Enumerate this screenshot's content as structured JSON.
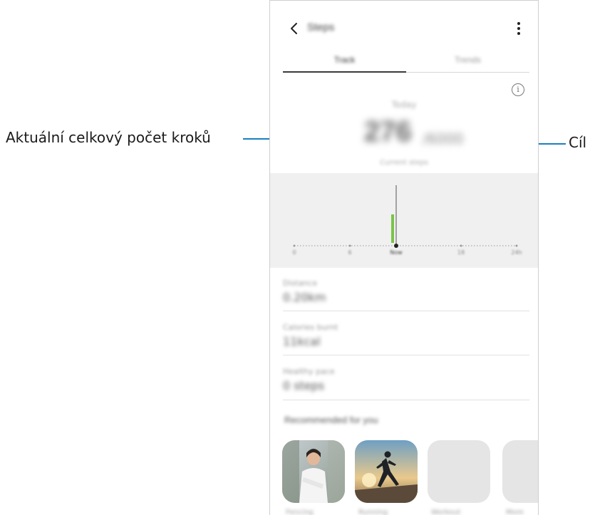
{
  "callouts": {
    "left_label": "Aktuální celkový počet kroků",
    "right_label": "Cíl"
  },
  "app_bar": {
    "title": "Steps"
  },
  "tabs": [
    {
      "label": "Track"
    },
    {
      "label": "Trends"
    }
  ],
  "summary": {
    "today_label": "Today",
    "steps_count": "276",
    "goal": "/6000",
    "sub_label": "Current steps"
  },
  "chart": {
    "tick_labels": [
      "0",
      "6",
      "Now",
      "18",
      "24h"
    ]
  },
  "stats": [
    {
      "label": "Distance",
      "value": "0.20km"
    },
    {
      "label": "Calories burnt",
      "value": "11kcal"
    },
    {
      "label": "Healthy pace",
      "value": "0 steps"
    }
  ],
  "recommended": {
    "title": "Recommended for you",
    "cards": [
      {
        "caption": "Fencing"
      },
      {
        "caption": "Running"
      },
      {
        "caption": "Workout"
      },
      {
        "caption": "More"
      }
    ]
  },
  "colors": {
    "callout_line": "#1a7fbf",
    "chart_bar": "#7bc24a",
    "chart_bg": "#f0f0f0"
  }
}
